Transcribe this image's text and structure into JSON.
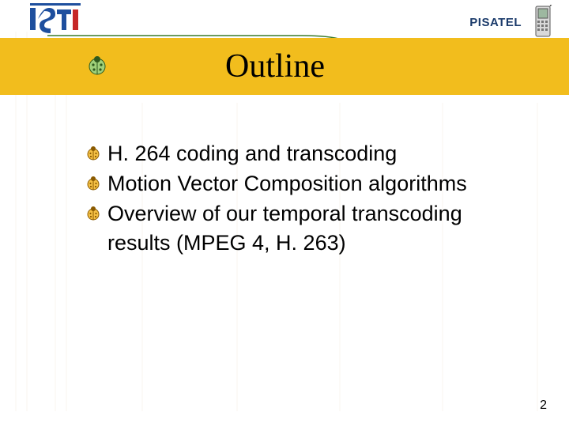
{
  "header": {
    "project_label": "PISATEL",
    "logo_alt": "ISTI logo"
  },
  "title": "Outline",
  "bullets": [
    {
      "text": "H. 264 coding and transcoding"
    },
    {
      "text": "Motion Vector Composition algorithms"
    },
    {
      "text": "Overview of our temporal transcoding"
    }
  ],
  "bullets_cont": "results (MPEG 4, H. 263)",
  "page_number": "2",
  "colors": {
    "band": "#f2bd1d",
    "accent_green": "#3a7a2a",
    "logo_blue": "#1e4f9e",
    "logo_red": "#c62828"
  }
}
